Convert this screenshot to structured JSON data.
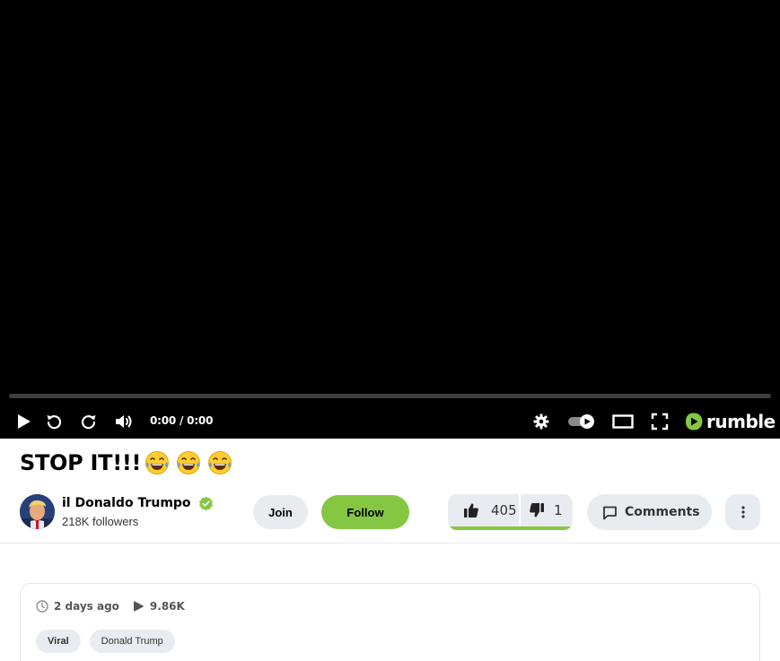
{
  "player": {
    "time_display": "0:00 / 0:00",
    "progress_fraction": 0,
    "accent_color": "#85c742",
    "brand_name": "rumble",
    "icons": [
      "play-icon",
      "replay-icon",
      "forward-icon",
      "volume-icon",
      "settings-icon",
      "autoplay-toggle-icon",
      "theater-mode-icon",
      "fullscreen-icon",
      "rumble-logo-icon"
    ]
  },
  "video": {
    "title": "STOP IT!!!",
    "title_emojis": [
      "laughing-tears-emoji",
      "laughing-tears-emoji",
      "laughing-tears-emoji"
    ]
  },
  "channel": {
    "name": "il Donaldo Trumpo",
    "followers": "218K followers",
    "verified": true
  },
  "actions": {
    "join_label": "Join",
    "follow_label": "Follow",
    "upvotes": "405",
    "downvotes": "1",
    "comments_label": "Comments"
  },
  "info": {
    "posted": "2 days ago",
    "views": "9.86K",
    "tags": [
      "Viral",
      "Donald Trump"
    ]
  },
  "colors": {
    "accent": "#85c742",
    "button_bg": "#e8ecf0",
    "player_bg": "#000000"
  }
}
